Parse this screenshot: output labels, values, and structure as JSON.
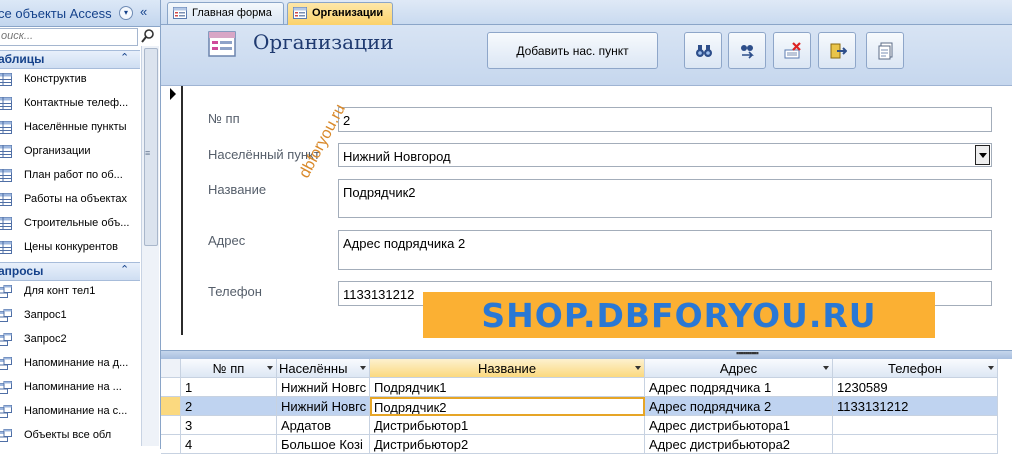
{
  "nav": {
    "title": "се объекты Access",
    "search_placeholder": "оиск...",
    "groups": [
      {
        "label": "аблицы",
        "items": [
          {
            "label": "Конструктив"
          },
          {
            "label": "Контактные телеф..."
          },
          {
            "label": "Населённые пункты"
          },
          {
            "label": "Организации"
          },
          {
            "label": "План работ по об..."
          },
          {
            "label": "Работы на объектах"
          },
          {
            "label": "Строительные объ..."
          },
          {
            "label": "Цены конкурентов"
          }
        ]
      },
      {
        "label": "апросы",
        "items": [
          {
            "label": "Для конт тел1"
          },
          {
            "label": "Запрос1"
          },
          {
            "label": "Запрос2"
          },
          {
            "label": "Напоминание на д..."
          },
          {
            "label": "Напоминание на ..."
          },
          {
            "label": "Напоминание на с..."
          },
          {
            "label": "Объекты все обл"
          }
        ]
      }
    ]
  },
  "tabs": [
    {
      "label": "Главная форма",
      "active": false
    },
    {
      "label": "Организации",
      "active": true
    }
  ],
  "form": {
    "title": "Организации",
    "add_button": "Добавить нас. пункт",
    "toolbar_icons": [
      "binoculars-icon",
      "find-replace-icon",
      "delete-record-icon",
      "exit-icon",
      "report-icon"
    ],
    "fields": {
      "num_label": "№ пп",
      "num_value": "2",
      "city_label": "Населённый пункт",
      "city_value": "Нижний Новгород",
      "name_label": "Название",
      "name_value": "Подрядчик2",
      "address_label": "Адрес",
      "address_value": "Адрес подрядчика 2",
      "phone_label": "Телефон",
      "phone_value": "1133131212"
    }
  },
  "watermarks": {
    "diagonal": "dbforyou.ru",
    "banner": "SHOP.DBFORYOU.RU"
  },
  "datasheet": {
    "columns": [
      "№ пп",
      "Населённы",
      "Название",
      "Адрес",
      "Телефон"
    ],
    "rows": [
      [
        "1",
        "Нижний Новгс",
        "Подрядчик1",
        "Адрес подрядчика 1",
        "1230589"
      ],
      [
        "2",
        "Нижний Новгс",
        "Подрядчик2",
        "Адрес подрядчика 2",
        "1133131212"
      ],
      [
        "3",
        "Ардатов",
        "Дистрибьютор1",
        "Адрес дистрибьютора1",
        ""
      ],
      [
        "4",
        "Большое Козі",
        "Дистрибьютор2",
        "Адрес дистрибьютора2",
        ""
      ]
    ],
    "selected_row": 1
  },
  "colors": {
    "accent": "#fbd97f",
    "banner_bg": "#fbb033",
    "banner_text": "#2a78d4",
    "header_bg": "#c6d7ee"
  }
}
